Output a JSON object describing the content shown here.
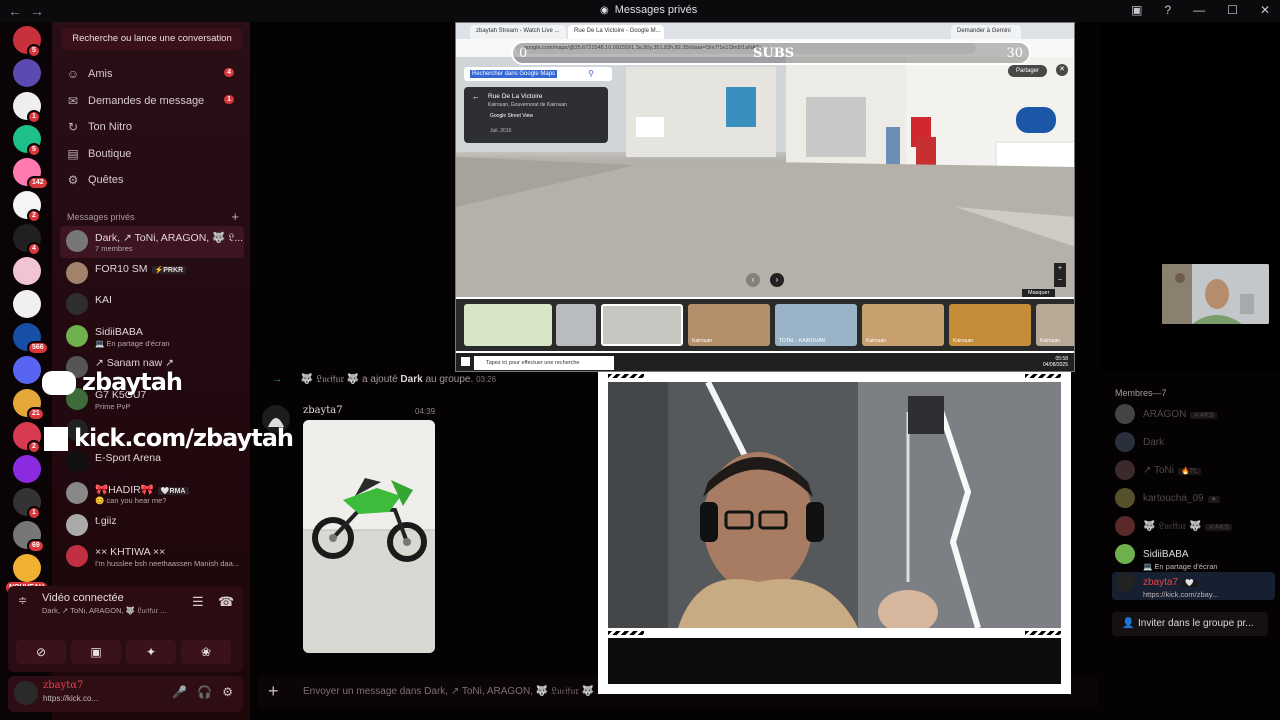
{
  "window": {
    "title": "Messages privés",
    "controls": [
      "▣",
      "?",
      "—",
      "☐",
      "✕"
    ]
  },
  "guilds": [
    {
      "badge": "5",
      "color": "#c8303c"
    },
    {
      "badge": "",
      "color": "#5b4bb0"
    },
    {
      "badge": "1",
      "color": "#eeeeee"
    },
    {
      "badge": "5",
      "color": "#1fbf8a"
    },
    {
      "badge": "142",
      "color": "#ff7ab0"
    },
    {
      "badge": "2",
      "color": "#f5f5f5"
    },
    {
      "badge": "4",
      "color": "#202020"
    },
    {
      "badge": "",
      "color": "#f2c3d0"
    },
    {
      "badge": "",
      "color": "#f0f0f0"
    },
    {
      "badge": "566",
      "color": "#174ea6"
    },
    {
      "badge": "",
      "color": "#5865f2"
    },
    {
      "badge": "21",
      "color": "#e6a73a"
    },
    {
      "badge": "2",
      "color": "#d83a52"
    },
    {
      "badge": "",
      "color": "#8a2be2"
    },
    {
      "badge": "1",
      "color": "#333333"
    },
    {
      "badge": "69",
      "color": "#777777"
    },
    {
      "badge": "",
      "color": "#f0b030"
    }
  ],
  "nouveau": "NOUVEAU",
  "sidebar": {
    "search": "Recherche ou lance une conversation",
    "nav": [
      {
        "icon": "☺",
        "label": "Amis",
        "count": "4"
      },
      {
        "icon": "✉",
        "label": "Demandes de message",
        "count": "1"
      },
      {
        "icon": "↻",
        "label": "Ton Nitro",
        "count": ""
      },
      {
        "icon": "▤",
        "label": "Boutique",
        "count": ""
      },
      {
        "icon": "⚙",
        "label": "Quêtes",
        "count": ""
      }
    ],
    "dm_header": "Messages privés",
    "dms": [
      {
        "name": "Dark, ↗ ToNi, ARAGON, 🐺 𝔏...",
        "sub": "7 membres",
        "tag": "",
        "color": "#777777"
      },
      {
        "name": "FOR10 SM",
        "sub": "",
        "tag": "⚡PRKR",
        "color": "#a0836a"
      },
      {
        "name": "KAI",
        "sub": "",
        "tag": "",
        "color": "#2e2e2e"
      },
      {
        "name": "SidiiBABA",
        "sub": "💻 En partage d'écran",
        "tag": "",
        "color": "#6db04c"
      },
      {
        "name": "↗ Sanam naw ↗",
        "sub": "",
        "tag": "",
        "color": "#555555"
      },
      {
        "name": "G7 K5OU7",
        "sub": "Prime PvP",
        "tag": "",
        "color": "#3e6b3a"
      },
      {
        "name": "",
        "sub": "",
        "tag": "",
        "color": "#222222"
      },
      {
        "name": "E-Sport Arena",
        "sub": "",
        "tag": "",
        "color": "#111111"
      },
      {
        "name": "🎀HADIR🎀",
        "sub": "😊 can you hear me?",
        "tag": "🤍RMA",
        "color": "#888888"
      },
      {
        "name": "t.giiz",
        "sub": "",
        "tag": "",
        "color": "#aaaaaa"
      },
      {
        "name": "×× KHTIWA ××",
        "sub": "I'm husslee bsh neethaassen Manish daa...",
        "tag": "",
        "color": "#c03040"
      }
    ],
    "voice": {
      "title": "Vidéo connectée",
      "sub": "Dark, ↗ ToNi, ARAGON, 🐺 𝔏𝔲𝔠𝔦𝔣𝔲𝔯 ...",
      "buttons": [
        "⊘",
        "▣",
        "✦",
        "❀"
      ]
    },
    "user": {
      "name": "zbaytα7",
      "status": "https://kick.co..."
    }
  },
  "overlay": {
    "brand1": "zbaytah",
    "brand2": "kick.com/zbaytah"
  },
  "chat": {
    "system_message": {
      "actor": "🐺 𝔏𝔲𝔠𝔦𝔣𝔲𝔯 🐺",
      "text": "a ajouté",
      "target": "Dark",
      "suffix": "au groupe.",
      "time": "03:26"
    },
    "message": {
      "author": "zbayta7",
      "time": "04:39"
    },
    "composer_placeholder": "Envoyer un message dans Dark, ↗ ToNi, ARAGON, 🐺 𝔏𝔲𝔠𝔦𝔣𝔲𝔯 🐺"
  },
  "stream": {
    "tabs": [
      "zbaytah Stream - Watch Live ...",
      "Rue De La Victoire - Google M...",
      "Demander à Gemini"
    ],
    "url": "google.com/maps/@35.6721548,10.0915591,3a,90y,351.83h,82.35t/data=!3m7!1e1!3m5!1sNAS!...",
    "subs_left": "0",
    "subs_center": "SUBS",
    "subs_right": "30",
    "search_selected": "Rechercher dans Google Maps",
    "card_title": "Rue De La Victoire",
    "card_sub": "Kairouan, Gouvernorat de Kairouan",
    "card_sv": "Google Street View",
    "card_date": "Juil. 2016",
    "share": "Partager",
    "hide": "Masquer",
    "thumbs": [
      "Kairouan",
      "Kairouan",
      "TOTAL - KAIROUAN",
      "Kairouan",
      "Kairouan"
    ],
    "taskbar_search": "Tapez ici pour effectuer une recherche",
    "clock": "05:58",
    "date": "04/08/2025"
  },
  "members": {
    "header": "Membres—7",
    "list": [
      {
        "name": "ARAGON",
        "tag": "☠AKS",
        "online": false,
        "status": "",
        "color": "#444444"
      },
      {
        "name": "Dark",
        "tag": "",
        "online": false,
        "status": "",
        "color": "#2a2f3c"
      },
      {
        "name": "↗ ToNi",
        "tag": "🔥TL",
        "online": false,
        "status": "",
        "color": "#3a2a2a"
      },
      {
        "name": "kartoucha_09",
        "tag": "★",
        "online": false,
        "status": "",
        "color": "#56512a"
      },
      {
        "name": "🐺 𝔏𝔲𝔠𝔦𝔣𝔲𝔯 🐺",
        "tag": "☠AKS",
        "online": false,
        "status": "",
        "color": "#5a2a2a"
      },
      {
        "name": "SidiiBABA",
        "tag": "",
        "online": true,
        "status": "💻 En partage d'écran",
        "color": "#6db04c"
      },
      {
        "name": "zbayta7",
        "tag": "🤍",
        "online": true,
        "status": "https://kick.com/zbay...",
        "color": "#222222"
      }
    ],
    "invite": "Inviter dans le groupe pr..."
  }
}
